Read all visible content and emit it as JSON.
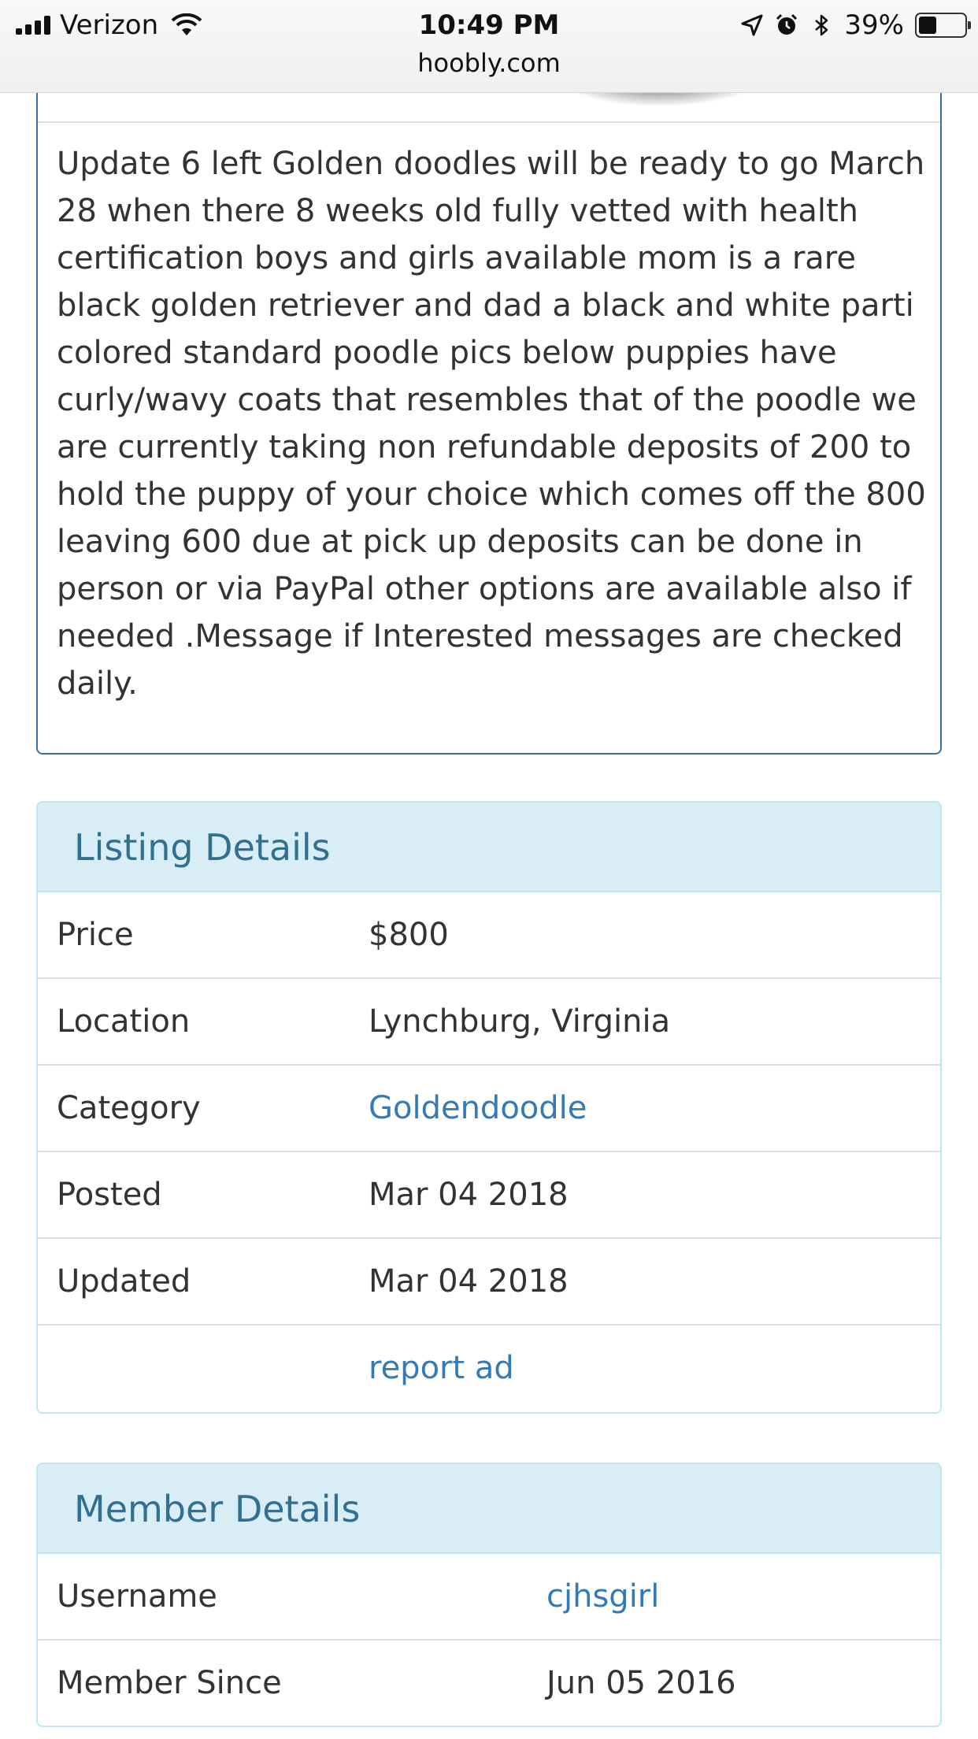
{
  "status_bar": {
    "carrier": "Verizon",
    "time": "10:49 PM",
    "battery_percent": "39%",
    "battery_level": 0.39,
    "url": "hoobly.com"
  },
  "description": "Update 6 left Golden doodles will be ready to go March 28 when there 8 weeks old fully vetted with health certification boys and girls available mom is a rare black golden retriever and dad a black and white parti colored standard poodle pics below puppies have curly/wavy coats that resembles that of the poodle we are currently taking non refundable deposits of 200 to hold the puppy of your choice which comes off the 800 leaving 600 due at pick up deposits can be done in person or via PayPal other options are available also if needed .Message if Interested messages are checked daily.",
  "listing_details": {
    "title": "Listing Details",
    "rows": [
      {
        "label": "Price",
        "value": "$800"
      },
      {
        "label": "Location",
        "value": "Lynchburg, Virginia"
      },
      {
        "label": "Category",
        "value": "Goldendoodle"
      },
      {
        "label": "Posted",
        "value": "Mar 04 2018"
      },
      {
        "label": "Updated",
        "value": "Mar 04 2018"
      },
      {
        "label": "",
        "value": "report ad"
      }
    ]
  },
  "member_details": {
    "title": "Member Details",
    "rows": [
      {
        "label": "Username",
        "value": "cjhsgirl"
      },
      {
        "label": "Member Since",
        "value": "Jun 05 2016"
      }
    ]
  },
  "colors": {
    "link": "#337ab7",
    "panel_heading_bg": "#d9edf7",
    "panel_heading_text": "#31708f",
    "description_border": "#3a70a6"
  }
}
